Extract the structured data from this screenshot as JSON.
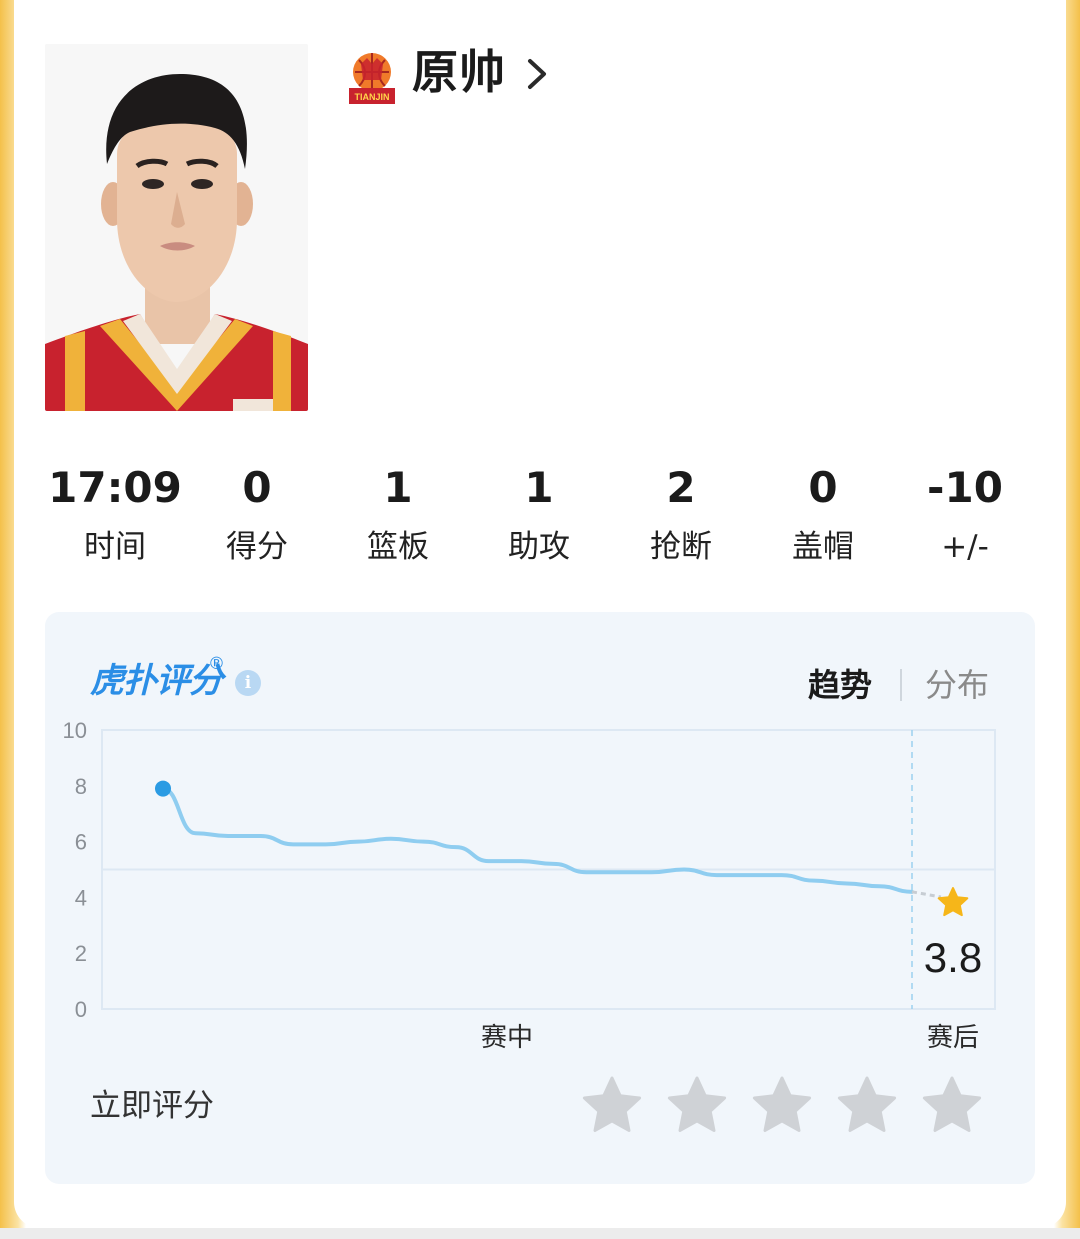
{
  "player": {
    "name": "原帅",
    "team_logo_text": "TIANJIN"
  },
  "stats": [
    {
      "value": "17:09",
      "label": "时间"
    },
    {
      "value": "0",
      "label": "得分"
    },
    {
      "value": "1",
      "label": "篮板"
    },
    {
      "value": "1",
      "label": "助攻"
    },
    {
      "value": "2",
      "label": "抢断"
    },
    {
      "value": "0",
      "label": "盖帽"
    },
    {
      "value": "-10",
      "label": "+/-"
    }
  ],
  "rating": {
    "brand": "虎扑评分",
    "registered": "®",
    "info_icon": "i",
    "tabs": {
      "trend": "趋势",
      "distribution": "分布"
    },
    "rate_now_label": "立即评分",
    "stars_count": 5
  },
  "chart_data": {
    "type": "line",
    "xlabel": "",
    "ylabel": "",
    "ylim": [
      0,
      10
    ],
    "yticks": [
      "10",
      "8",
      "6",
      "4",
      "2",
      "0"
    ],
    "x_labels": [
      "赛中",
      "赛后"
    ],
    "grid": true,
    "series": [
      {
        "values": [
          7.9,
          6.3,
          6.2,
          6.2,
          5.9,
          5.9,
          6.0,
          6.1,
          6.0,
          5.8,
          5.3,
          5.3,
          5.2,
          4.9,
          4.9,
          4.9,
          5.0,
          4.8,
          4.8,
          4.8,
          4.6,
          4.5,
          4.4,
          4.2
        ]
      }
    ],
    "final_value": "3.8",
    "final_value_num": 3.8,
    "colors": {
      "line": "#8fcdf0",
      "start_dot": "#2b9be3",
      "star": "#f6b619",
      "grid": "#dde8f3"
    }
  }
}
